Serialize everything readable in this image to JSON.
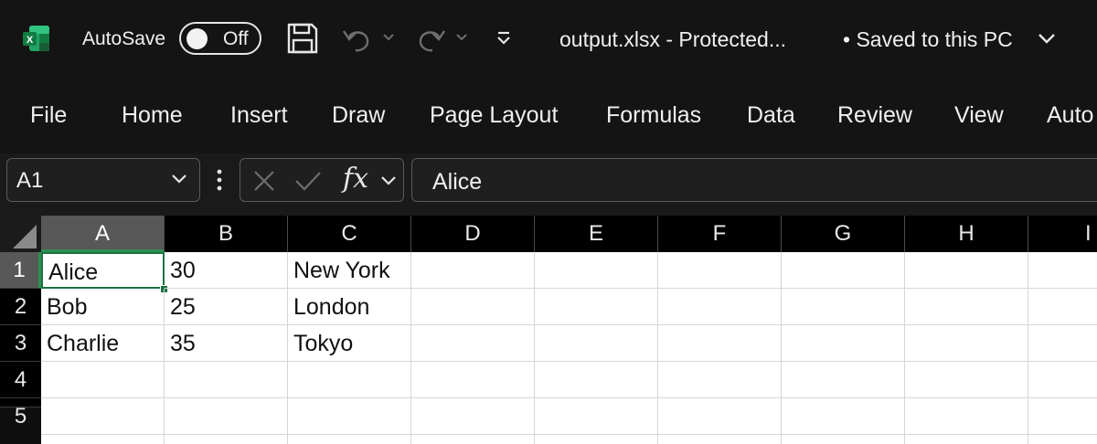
{
  "titlebar": {
    "autosave_label": "AutoSave",
    "autosave_state": "Off",
    "document_title": "output.xlsx  -  Protected...",
    "save_status": "• Saved to this PC",
    "icons": [
      "excel-logo-icon",
      "save-icon",
      "undo-icon",
      "redo-icon",
      "customize-toolbar-icon"
    ]
  },
  "ribbon": {
    "tabs": [
      "File",
      "Home",
      "Insert",
      "Draw",
      "Page Layout",
      "Formulas",
      "Data",
      "Review",
      "View",
      "Auto"
    ]
  },
  "formula_bar": {
    "name_box": "A1",
    "fx_label": "fx",
    "content": "Alice"
  },
  "grid": {
    "columns": [
      "A",
      "B",
      "C",
      "D",
      "E",
      "F",
      "G",
      "H",
      "I"
    ],
    "rows": [
      "1",
      "2",
      "3",
      "4",
      "5"
    ],
    "selected_cell": "A1",
    "data": [
      [
        "Alice",
        "30",
        "New York"
      ],
      [
        "Bob",
        "25",
        "London"
      ],
      [
        "Charlie",
        "35",
        "Tokyo"
      ]
    ]
  },
  "colors": {
    "accent_green": "#1e7145",
    "dark_bg": "#141414",
    "sheet_bg": "#ffffff"
  }
}
